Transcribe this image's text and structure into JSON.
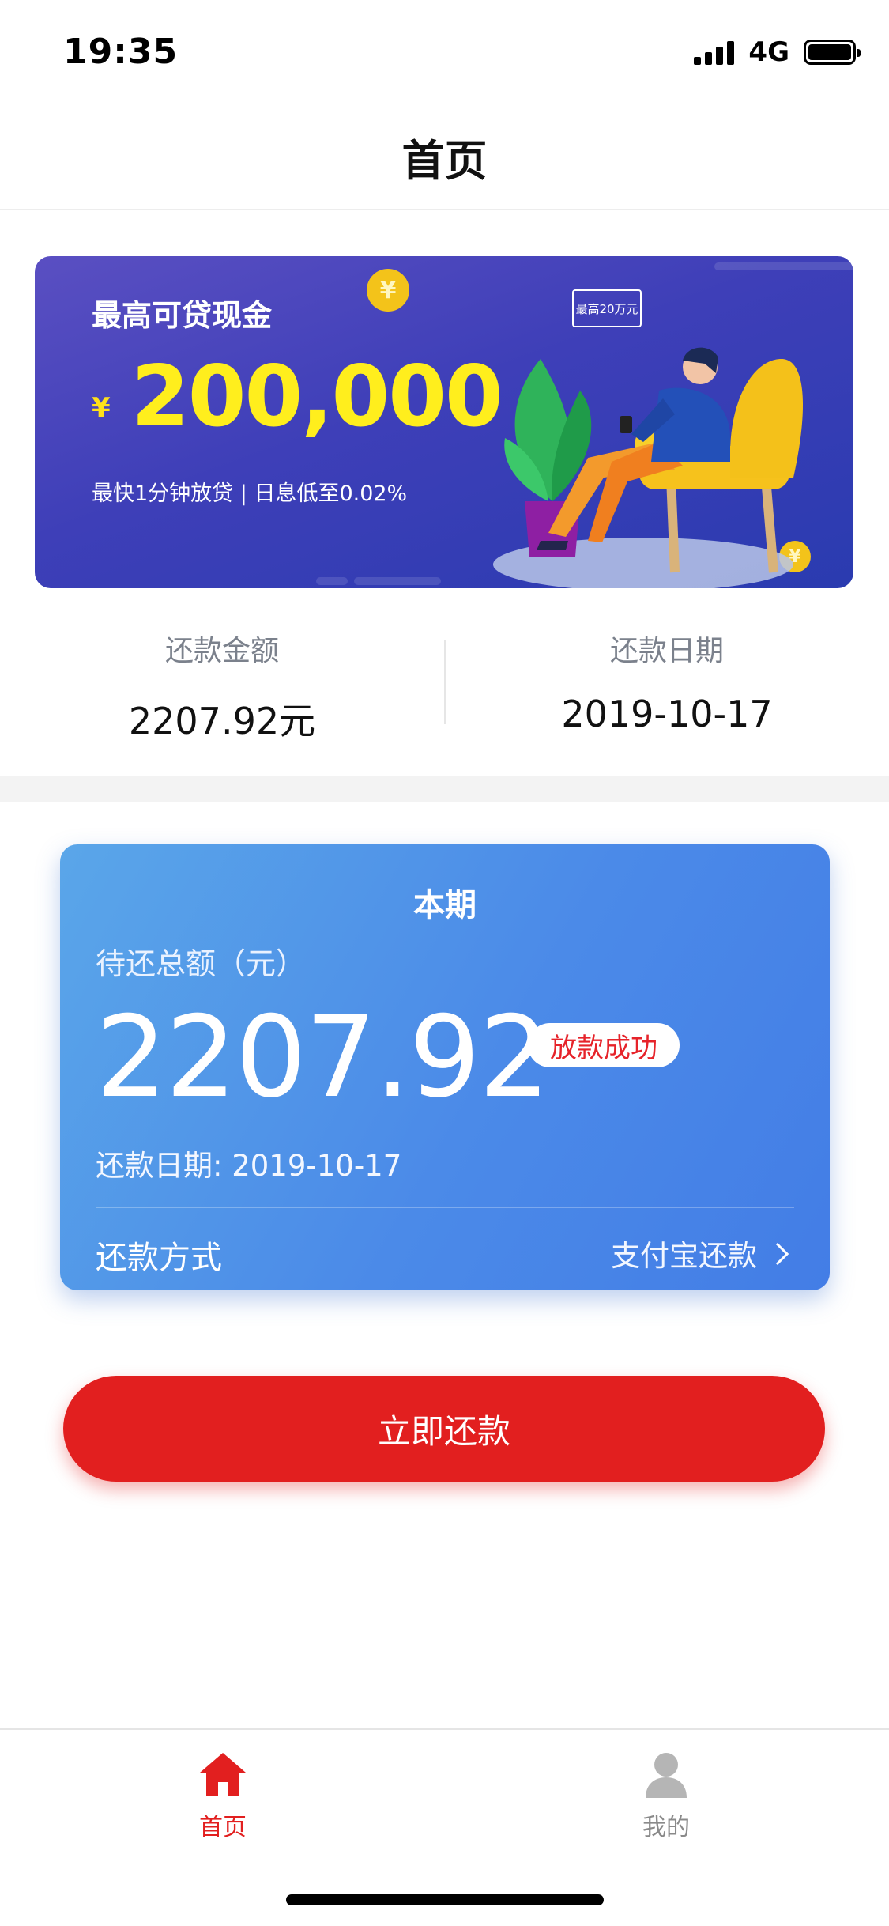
{
  "status_bar": {
    "time": "19:35",
    "network": "4G"
  },
  "nav": {
    "title": "首页"
  },
  "banner": {
    "title": "最高可贷现金",
    "currency": "¥",
    "amount": "200,000",
    "subtitle": "最快1分钟放贷 | 日息低至0.02%",
    "bubble_text": "最高20万元",
    "coin_symbol": "¥"
  },
  "summary": {
    "amount_label": "还款金额",
    "amount_value": "2207.92元",
    "date_label": "还款日期",
    "date_value": "2019-10-17"
  },
  "card": {
    "title": "本期",
    "label": "待还总额（元）",
    "amount": "2207.92",
    "status": "放款成功",
    "date": "还款日期: 2019-10-17",
    "method_label": "还款方式",
    "method_value": "支付宝还款"
  },
  "repay_button": {
    "label": "立即还款"
  },
  "tabs": [
    {
      "label": "首页",
      "icon": "home-icon",
      "active": true
    },
    {
      "label": "我的",
      "icon": "user-icon",
      "active": false
    }
  ],
  "colors": {
    "accent_red": "#e21f1f",
    "card_blue": "#4b8ae8",
    "banner_purple": "#3e3fb8",
    "banner_yellow": "#ffee1d"
  }
}
